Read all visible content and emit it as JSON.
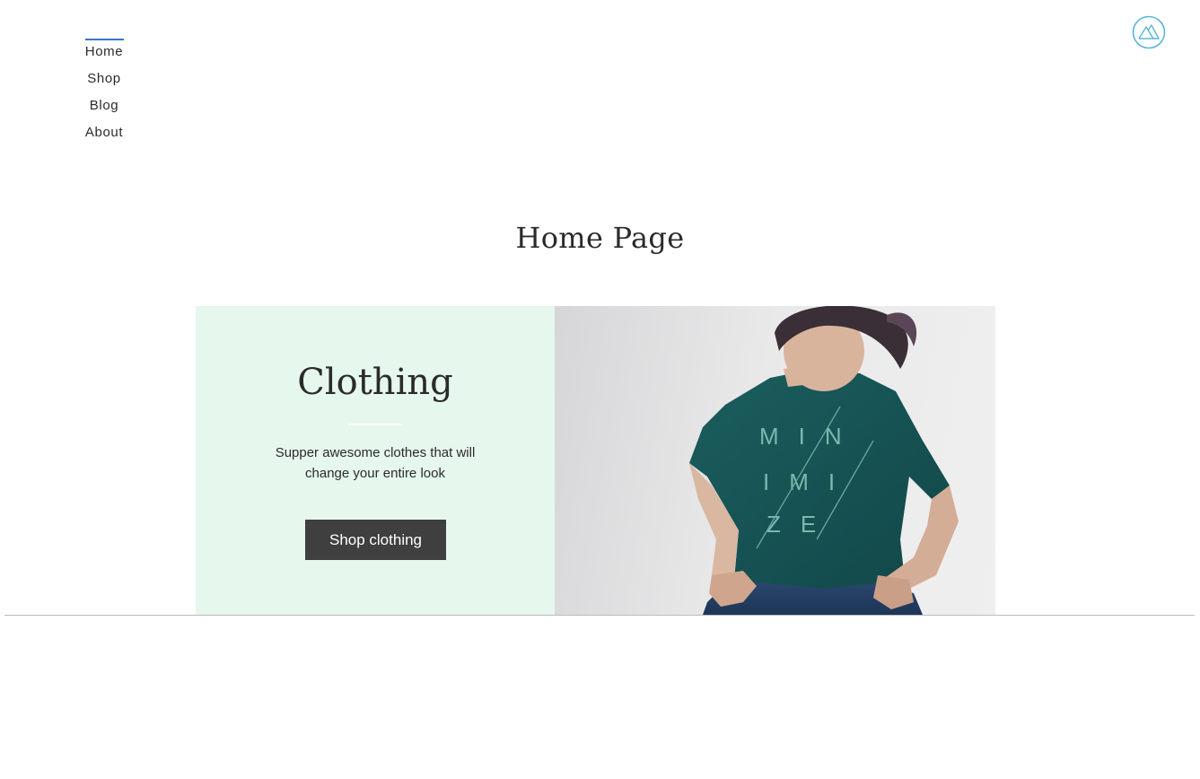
{
  "nav": {
    "items": [
      {
        "label": "Home",
        "active": true
      },
      {
        "label": "Shop",
        "active": false
      },
      {
        "label": "Blog",
        "active": false
      },
      {
        "label": "About",
        "active": false
      }
    ]
  },
  "logo": {
    "icon": "mountain-logo-icon",
    "color": "#5bb5d9"
  },
  "page": {
    "title": "Home Page"
  },
  "banner": {
    "title": "Clothing",
    "description": "Supper awesome clothes that will change your entire look",
    "button_label": "Shop clothing",
    "background_color": "#e6f7ee",
    "image": {
      "shirt_text_rows": [
        "M I N",
        "I M I",
        "Z E"
      ]
    }
  },
  "colors": {
    "accent": "#3b74c9",
    "button": "#3f3f3f"
  }
}
